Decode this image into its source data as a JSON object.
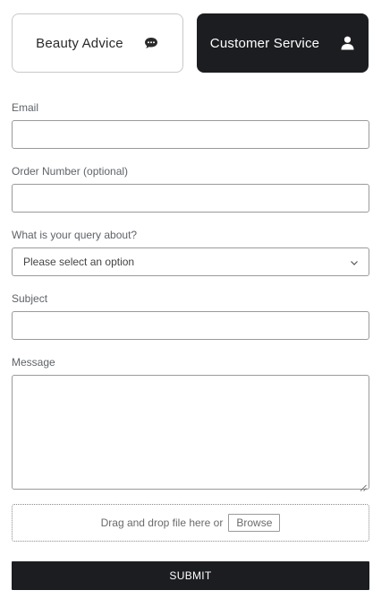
{
  "tabs": [
    {
      "label": "Beauty Advice",
      "icon": "chat-bubble-icon"
    },
    {
      "label": "Customer Service",
      "icon": "user-icon",
      "active": true
    }
  ],
  "form": {
    "email_label": "Email",
    "order_label": "Order Number (optional)",
    "query_label": "What is your query about?",
    "query_selected": "Please select an option",
    "subject_label": "Subject",
    "message_label": "Message",
    "upload_text": "Drag and drop file here or",
    "browse_label": "Browse",
    "submit_label": "SUBMIT"
  },
  "colors": {
    "accent_dark": "#1b1d20",
    "border": "#9a9a9a",
    "label_text": "#5f6368"
  }
}
